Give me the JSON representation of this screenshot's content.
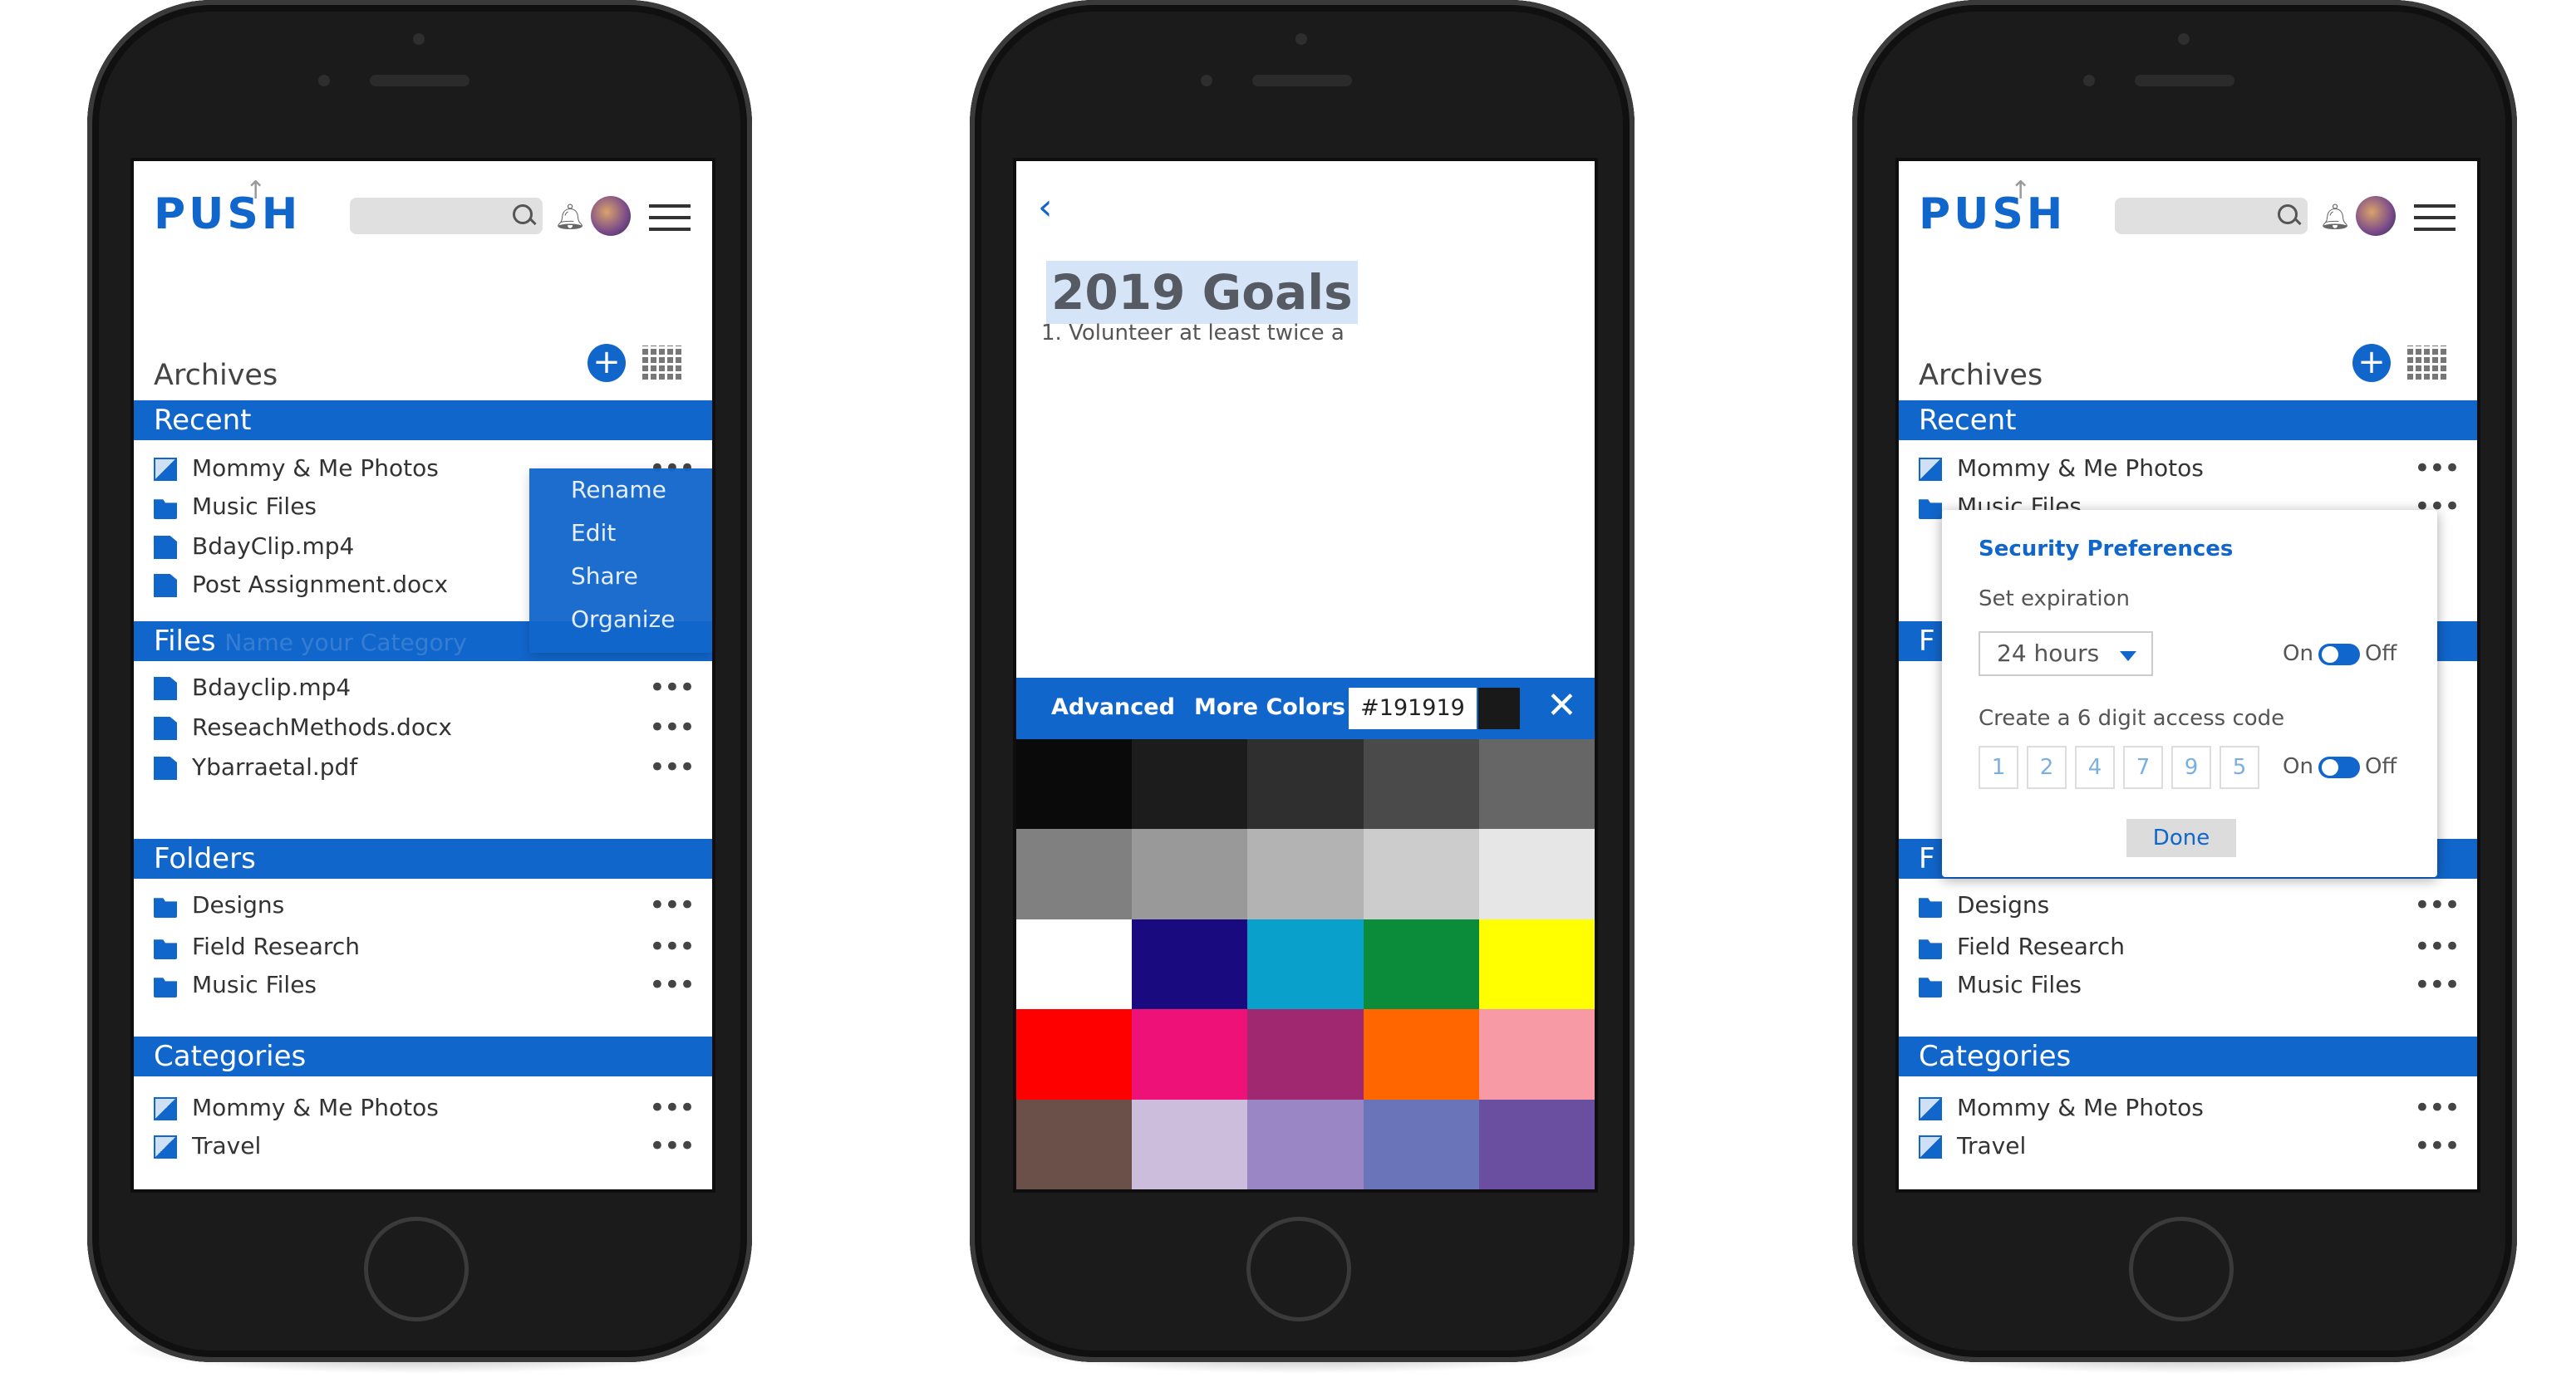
{
  "brand": {
    "logo_text": "PUSH",
    "accent": "#1166cc"
  },
  "phone1": {
    "archives": "Archives",
    "recent": {
      "title": "Recent",
      "items": [
        {
          "label": "Mommy & Me Photos",
          "icon": "gallery-icon"
        },
        {
          "label": "Music Files",
          "icon": "folder-icon"
        },
        {
          "label": "BdayClip.mp4",
          "icon": "video-file-icon"
        },
        {
          "label": "Post Assignment.docx",
          "icon": "document-icon"
        }
      ]
    },
    "context_menu": [
      "Rename",
      "Edit",
      "Share",
      "Organize"
    ],
    "files": {
      "title": "Files",
      "overlay_text": "Name your Category",
      "items": [
        {
          "label": "Bdayclip.mp4",
          "icon": "video-file-icon"
        },
        {
          "label": "ReseachMethods.docx",
          "icon": "document-icon"
        },
        {
          "label": "Ybarraetal.pdf",
          "icon": "pdf-file-icon"
        }
      ]
    },
    "folders": {
      "title": "Folders",
      "items": [
        {
          "label": "Designs"
        },
        {
          "label": "Field Research"
        },
        {
          "label": "Music Files"
        }
      ]
    },
    "categories": {
      "title": "Categories",
      "items": [
        {
          "label": "Mommy & Me Photos"
        },
        {
          "label": "Travel"
        }
      ]
    },
    "more_label": "•••"
  },
  "phone2": {
    "back_icon": "chevron-left-icon",
    "title": "2019 Goals",
    "line1": "1. Volunteer at least twice a",
    "picker": {
      "advanced": "Advanced",
      "more_colors": "More Colors",
      "hex": "#191919",
      "current_color": "#191919",
      "close": "✕"
    },
    "swatches": [
      "#0a0a0a",
      "#1c1c1c",
      "#2f2f2f",
      "#4a4a4a",
      "#666666",
      "#808080",
      "#999999",
      "#b3b3b3",
      "#cccccc",
      "#e6e6e6",
      "#ffffff",
      "#1a0a80",
      "#0aa0cc",
      "#0a8c3a",
      "#ffff00",
      "#ff0000",
      "#ee1177",
      "#a02870",
      "#ff6600",
      "#f79aa5",
      "#6a5048",
      "#ccbddc",
      "#9a86c4",
      "#6a74b8",
      "#6a4fa0"
    ]
  },
  "phone3": {
    "archives": "Archives",
    "recent_title": "Recent",
    "recent_items": [
      "Mommy & Me Photos",
      "Music Files"
    ],
    "files_title_partial": "F",
    "folders_title_partial": "F",
    "folders_items": [
      "Designs",
      "Field Research",
      "Music Files"
    ],
    "categories_title": "Categories",
    "categories_items": [
      "Mommy & Me Photos",
      "Travel"
    ],
    "security": {
      "title": "Security Preferences",
      "set_expiration": "Set expiration",
      "expiration_value": "24 hours",
      "on": "On",
      "off": "Off",
      "code_label": "Create a 6 digit access code",
      "digits": [
        "1",
        "2",
        "4",
        "7",
        "9",
        "5"
      ],
      "done": "Done"
    }
  }
}
